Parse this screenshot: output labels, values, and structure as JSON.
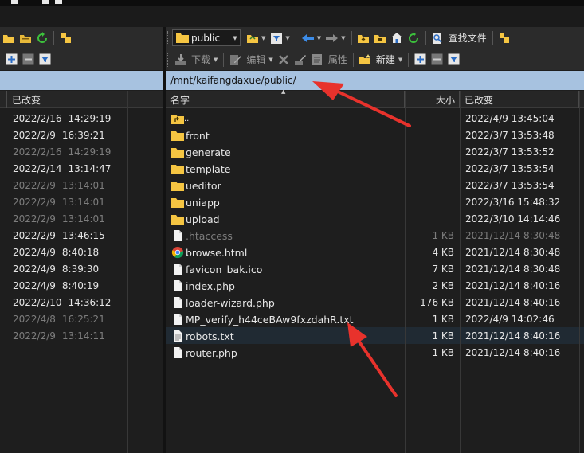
{
  "left_toolbar": {
    "icons": [
      "folder-new-icon",
      "refresh-icon",
      "bookmark-icon",
      "add-icon",
      "remove-icon",
      "filter-icon"
    ]
  },
  "right_toolbar": {
    "location": "public",
    "search_label": "查找文件",
    "download_label": "下载",
    "edit_label": "编辑",
    "properties_label": "属性",
    "new_label": "新建"
  },
  "left_path": "",
  "right_path": "/mnt/kaifangdaxue/public/",
  "left_pane": {
    "column_modified": "已改变",
    "rows": [
      {
        "date": "2022/2/16",
        "time": "14:29:19",
        "dim": false
      },
      {
        "date": "2022/2/9",
        "time": "16:39:21",
        "dim": false
      },
      {
        "date": "2022/2/16",
        "time": "14:29:19",
        "dim": true
      },
      {
        "date": "2022/2/14",
        "time": "13:14:47",
        "dim": false
      },
      {
        "date": "2022/2/9",
        "time": "13:14:01",
        "dim": true
      },
      {
        "date": "2022/2/9",
        "time": "13:14:01",
        "dim": true
      },
      {
        "date": "2022/2/9",
        "time": "13:14:01",
        "dim": true
      },
      {
        "date": "2022/2/9",
        "time": "13:46:15",
        "dim": false
      },
      {
        "date": "2022/4/9",
        "time": "8:40:18",
        "dim": false
      },
      {
        "date": "2022/4/9",
        "time": "8:39:30",
        "dim": false
      },
      {
        "date": "2022/4/9",
        "time": "8:40:19",
        "dim": false
      },
      {
        "date": "2022/2/10",
        "time": "14:36:12",
        "dim": false
      },
      {
        "date": "2022/4/8",
        "time": "16:25:21",
        "dim": true
      },
      {
        "date": "2022/2/9",
        "time": "13:14:11",
        "dim": true
      }
    ]
  },
  "right_pane": {
    "column_name": "名字",
    "column_size": "大小",
    "column_modified": "已改变",
    "files": [
      {
        "name": "..",
        "type": "parent",
        "size": "",
        "modified": "2022/4/9 13:45:04",
        "dim": false
      },
      {
        "name": "front",
        "type": "folder",
        "size": "",
        "modified": "2022/3/7 13:53:48",
        "dim": false
      },
      {
        "name": "generate",
        "type": "folder",
        "size": "",
        "modified": "2022/3/7 13:53:52",
        "dim": false
      },
      {
        "name": "template",
        "type": "folder",
        "size": "",
        "modified": "2022/3/7 13:53:54",
        "dim": false
      },
      {
        "name": "ueditor",
        "type": "folder",
        "size": "",
        "modified": "2022/3/7 13:53:54",
        "dim": false
      },
      {
        "name": "uniapp",
        "type": "folder",
        "size": "",
        "modified": "2022/3/16 15:48:32",
        "dim": false
      },
      {
        "name": "upload",
        "type": "folder",
        "size": "",
        "modified": "2022/3/10 14:14:46",
        "dim": false
      },
      {
        "name": ".htaccess",
        "type": "file",
        "size": "1 KB",
        "modified": "2021/12/14 8:30:48",
        "dim": true
      },
      {
        "name": "browse.html",
        "type": "html",
        "size": "4 KB",
        "modified": "2021/12/14 8:30:48",
        "dim": false
      },
      {
        "name": "favicon_bak.ico",
        "type": "file",
        "size": "7 KB",
        "modified": "2021/12/14 8:30:48",
        "dim": false
      },
      {
        "name": "index.php",
        "type": "file",
        "size": "2 KB",
        "modified": "2021/12/14 8:40:16",
        "dim": false
      },
      {
        "name": "loader-wizard.php",
        "type": "file",
        "size": "176 KB",
        "modified": "2021/12/14 8:40:16",
        "dim": false
      },
      {
        "name": "MP_verify_h44ceBAw9fxzdahR.txt",
        "type": "file",
        "size": "1 KB",
        "modified": "2022/4/9 14:02:46",
        "dim": false
      },
      {
        "name": "robots.txt",
        "type": "txt",
        "size": "1 KB",
        "modified": "2021/12/14 8:40:16",
        "dim": false,
        "selected": true
      },
      {
        "name": "router.php",
        "type": "file",
        "size": "1 KB",
        "modified": "2021/12/14 8:40:16",
        "dim": false
      }
    ]
  },
  "colors": {
    "annotation_arrow": "#e8322c",
    "folder": "#f5c542",
    "path_bar": "#a7c2e0",
    "background": "#1e1e1e"
  }
}
